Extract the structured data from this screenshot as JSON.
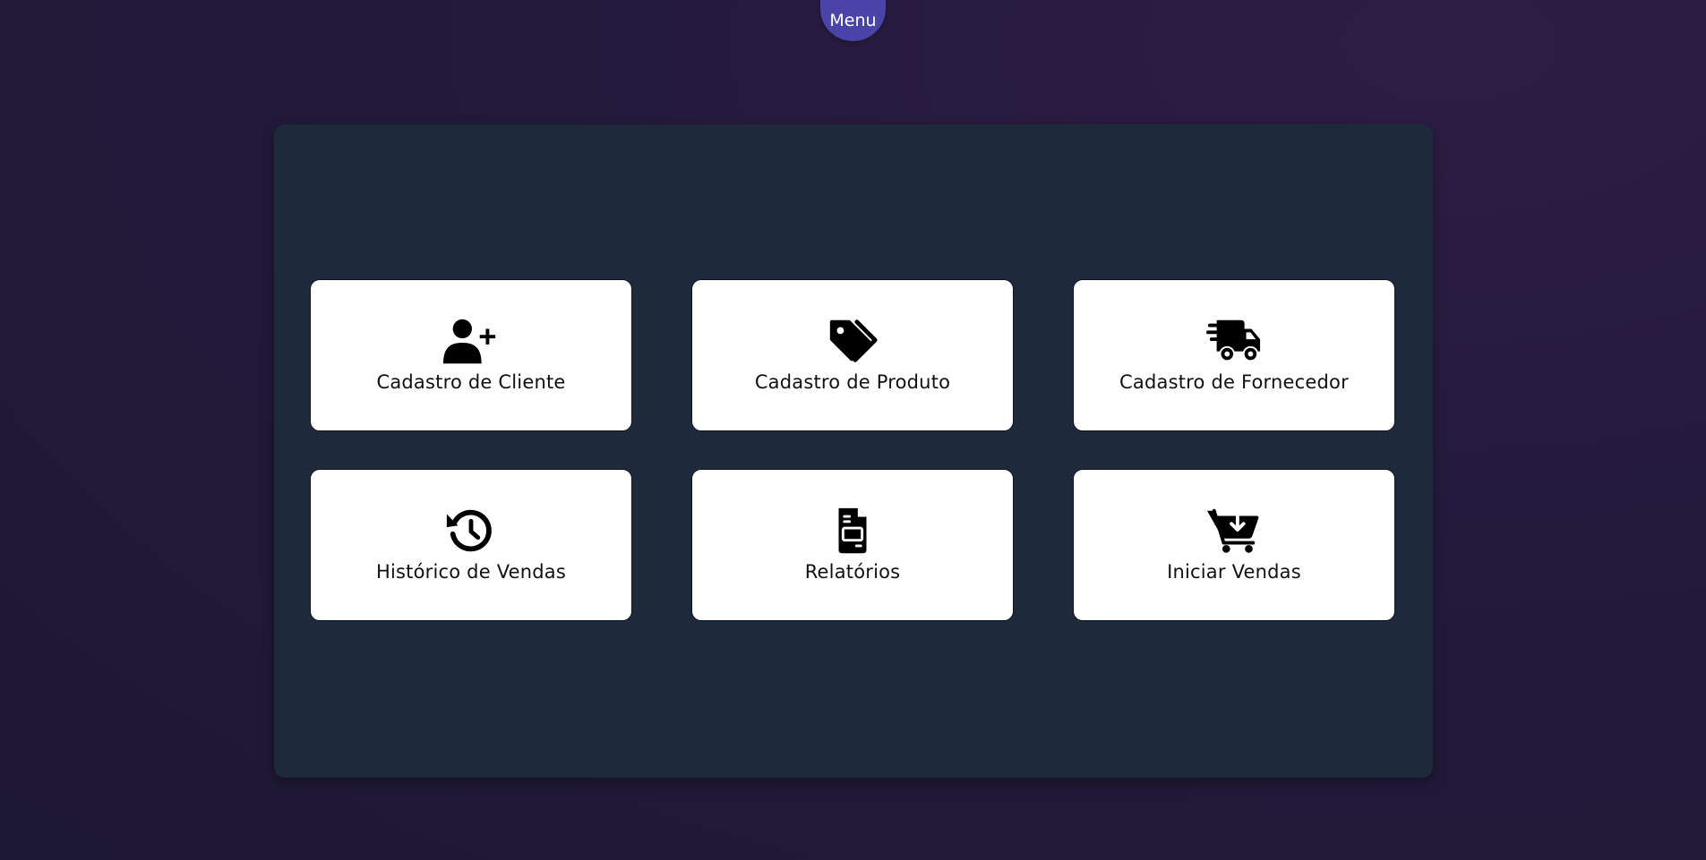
{
  "menu": {
    "label": "Menu",
    "color": "#4a44a8"
  },
  "colors": {
    "panel_background": "#1e2a3b",
    "card_background": "#ffffff",
    "icon_color": "#000000"
  },
  "cards": [
    {
      "label": "Cadastro de Cliente",
      "icon": "user-plus-icon"
    },
    {
      "label": "Cadastro de Produto",
      "icon": "tags-icon"
    },
    {
      "label": "Cadastro de Fornecedor",
      "icon": "truck-fast-icon"
    },
    {
      "label": "Histórico de Vendas",
      "icon": "history-icon"
    },
    {
      "label": "Relatórios",
      "icon": "file-report-icon"
    },
    {
      "label": "Iniciar Vendas",
      "icon": "cart-arrow-down-icon"
    }
  ]
}
